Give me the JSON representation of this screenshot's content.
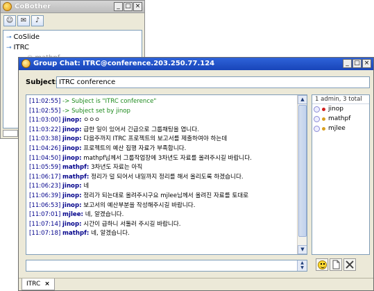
{
  "cobother": {
    "title": "CoBother",
    "win_buttons": [
      "_",
      "□",
      "×"
    ],
    "toolbar_icons": [
      "smiley-icon",
      "message-icon",
      "speaker-icon"
    ],
    "tree": [
      {
        "key": "⊸",
        "label": "CoSlide"
      },
      {
        "key": "⊸",
        "label": "ITRC"
      },
      {
        "label": "mathpf",
        "sub": true
      }
    ]
  },
  "chat": {
    "title": "Group Chat: ITRC@conference.203.250.77.124",
    "win_buttons": [
      "_",
      "□",
      "×"
    ],
    "subject_label": "Subject:",
    "subject_value": "ITRC conference",
    "messages": [
      {
        "time": "[11:02:55]",
        "text": "-> Subject is \"ITRC conference\"",
        "system": true
      },
      {
        "time": "[11:02:55]",
        "text": "-> Subject set by jinop",
        "system": true
      },
      {
        "time": "[11:03:00]",
        "nick": "jinop:",
        "text": "ㅇㅇㅇ"
      },
      {
        "time": "[11:03:22]",
        "nick": "jinop:",
        "text": "급한 일이 있어서 긴급으로 그룹채팅을 엽니다."
      },
      {
        "time": "[11:03:38]",
        "nick": "jinop:",
        "text": "다음주까지 ITRC 프로젝트의 보고서를 제출하여야 하는데"
      },
      {
        "time": "[11:04:26]",
        "nick": "jinop:",
        "text": "프로젝트의 예산 집행 자료가 부족합니다."
      },
      {
        "time": "[11:04:50]",
        "nick": "jinop:",
        "text": "mathpf님께서 그룹작업장에 3차년도 자료를 올려주시길 바랍니다."
      },
      {
        "time": "[11:05:59]",
        "nick": "mathpf:",
        "text": "3차년도 자료는 아직"
      },
      {
        "time": "[11:06:17]",
        "nick": "mathpf:",
        "text": "정리가 덜 되어서 내일까지 정리를 해서 올리도록 하겠습니다."
      },
      {
        "time": "[11:06:23]",
        "nick": "jinop:",
        "text": "네"
      },
      {
        "time": "[11:06:39]",
        "nick": "jinop:",
        "text": "정리가 되는대로 올려주시구요 mjlee님께서 올려진 자료를 토대로"
      },
      {
        "time": "[11:06:53]",
        "nick": "jinop:",
        "text": "보고서의 예산부분을 작성해주시길 바랍니다."
      },
      {
        "time": "[11:07:01]",
        "nick": "mjlee:",
        "text": "네, 알겠습니다."
      },
      {
        "time": "[11:07:14]",
        "nick": "jinop:",
        "text": "시간이 급하니 서둘러 주시길 바랍니다."
      },
      {
        "time": "[11:07:18]",
        "nick": "mathpf:",
        "text": "네, 알겠습니다."
      }
    ],
    "users_header": "1 admin, 3 total",
    "users": [
      {
        "name": "jinop",
        "status_color": "#d22020"
      },
      {
        "name": "mathpf",
        "status_color": "#d9a020"
      },
      {
        "name": "mjlee",
        "status_color": "#d9a020"
      }
    ],
    "input_value": "",
    "tools": [
      "smiley-icon",
      "file-icon",
      "tools-icon"
    ],
    "tab_label": "ITRC",
    "tab_close": "×"
  }
}
